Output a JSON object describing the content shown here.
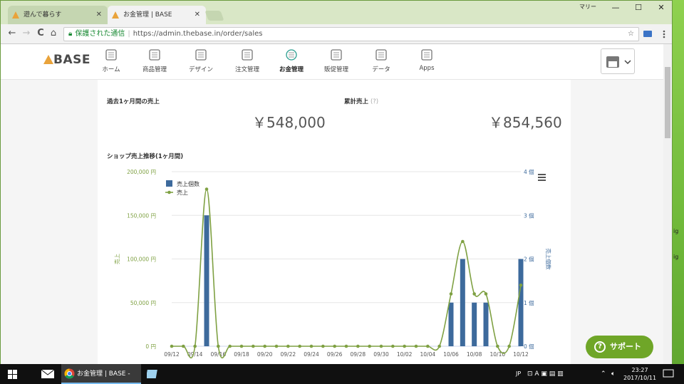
{
  "browser": {
    "tabs": [
      {
        "label": "遊んで暮らす"
      },
      {
        "label": "お金管理 | BASE"
      }
    ],
    "user": "マリー",
    "window_controls": {
      "minimize": "—",
      "maximize": "☐",
      "close": "✕"
    },
    "nav": {
      "back": "←",
      "forward": "→",
      "reload": "C",
      "home": "⌂"
    },
    "address": {
      "secure_label": "保護された通信",
      "url": "https://admin.thebase.in/order/sales",
      "star": "☆"
    }
  },
  "shop_nav": {
    "logo": "BASE",
    "items": [
      {
        "label": "ホーム",
        "icon": "home-icon"
      },
      {
        "label": "商品管理",
        "icon": "tshirt-icon"
      },
      {
        "label": "デザイン",
        "icon": "design-tools-icon"
      },
      {
        "label": "注文管理",
        "icon": "order-list-icon"
      },
      {
        "label": "お金管理",
        "icon": "yen-icon"
      },
      {
        "label": "販促管理",
        "icon": "phone-icon"
      },
      {
        "label": "データ",
        "icon": "chart-icon"
      },
      {
        "label": "Apps",
        "icon": "flask-icon"
      }
    ],
    "active": "お金管理",
    "store_icon": "store-icon"
  },
  "summary": {
    "month_label": "過去1ヶ月間の売上",
    "month_value": "￥548,000",
    "total_label": "累計売上",
    "total_help": "(?)",
    "total_value": "￥854,560"
  },
  "chart_data": {
    "type": "bar+line",
    "title": "ショップ売上推移(1ヶ月間)",
    "x": [
      "09/12",
      "09/13",
      "09/14",
      "09/15",
      "09/16",
      "09/17",
      "09/18",
      "09/19",
      "09/20",
      "09/21",
      "09/22",
      "09/23",
      "09/24",
      "09/25",
      "09/26",
      "09/27",
      "09/28",
      "09/29",
      "09/30",
      "10/01",
      "10/02",
      "10/03",
      "10/04",
      "10/05",
      "10/06",
      "10/07",
      "10/08",
      "10/09",
      "10/10",
      "10/11",
      "10/12"
    ],
    "tick_labels": [
      "09/12",
      "09/14",
      "09/16",
      "09/18",
      "09/20",
      "09/22",
      "09/24",
      "09/26",
      "09/28",
      "09/30",
      "10/02",
      "10/04",
      "10/06",
      "10/08",
      "10/10",
      "10/12"
    ],
    "series": [
      {
        "name": "売上個数",
        "type": "bar",
        "axis": "right",
        "color": "#3d6a9c",
        "values": [
          0,
          0,
          0,
          3,
          0,
          0,
          0,
          0,
          0,
          0,
          0,
          0,
          0,
          0,
          0,
          0,
          0,
          0,
          0,
          0,
          0,
          0,
          0,
          0,
          1,
          2,
          1,
          1,
          0,
          0,
          2
        ]
      },
      {
        "name": "売上",
        "type": "line",
        "axis": "left",
        "color": "#7fa143",
        "values": [
          0,
          0,
          0,
          180000,
          0,
          0,
          0,
          0,
          0,
          0,
          0,
          0,
          0,
          0,
          0,
          0,
          0,
          0,
          0,
          0,
          0,
          0,
          0,
          0,
          60000,
          120000,
          60000,
          60000,
          0,
          0,
          70000
        ]
      }
    ],
    "y_left": {
      "label": "売上",
      "ticks": [
        "0 円",
        "50,000 円",
        "100,000 円",
        "150,000 円",
        "200,000 円"
      ],
      "range": [
        0,
        200000
      ]
    },
    "y_right": {
      "label": "売上個数",
      "ticks": [
        "0 個",
        "1 個",
        "2 個",
        "3 個",
        "4 個"
      ],
      "range": [
        0,
        4
      ]
    },
    "menu_icon": "hamburger-icon",
    "legend_position": "top-left"
  },
  "support": {
    "label": "サポート"
  },
  "taskbar": {
    "chrome_label": "お金管理 | BASE - G...",
    "ime": "JP",
    "time": "23:27",
    "date": "2017/10/11"
  },
  "desktop_fragments": [
    "ig",
    "ig"
  ]
}
